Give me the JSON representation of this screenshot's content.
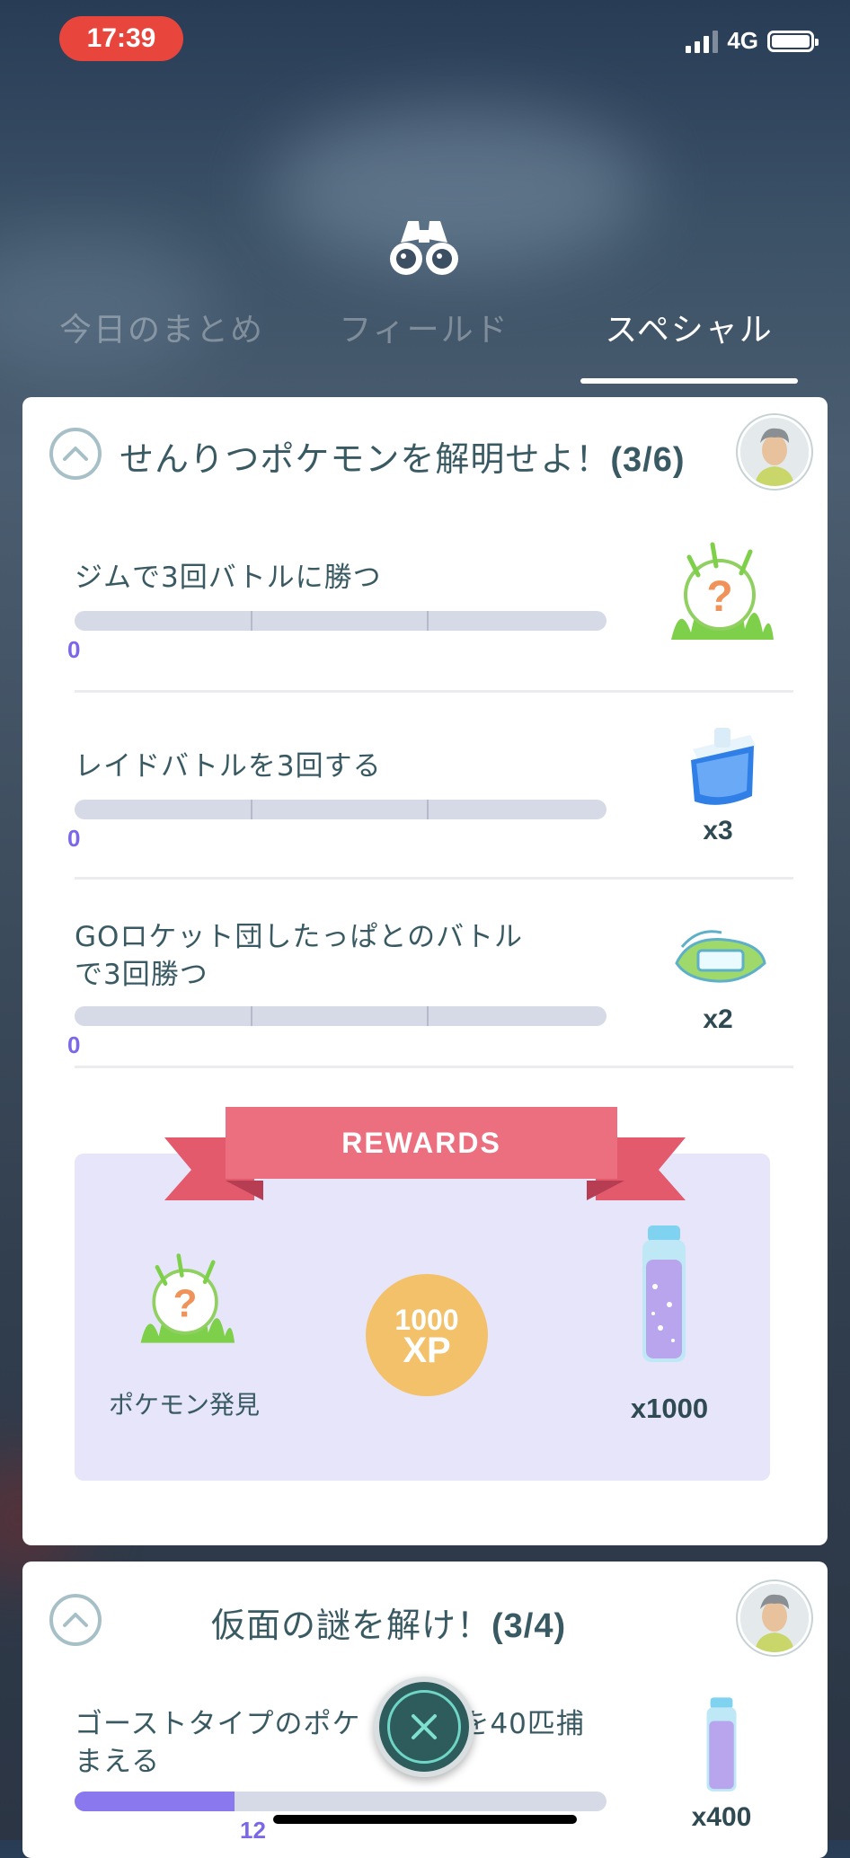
{
  "status_bar": {
    "time": "17:39",
    "network": "4G"
  },
  "header": {
    "icon": "binoculars-icon"
  },
  "tabs": [
    {
      "label": "今日のまとめ",
      "active": false
    },
    {
      "label": "フィールド",
      "active": false
    },
    {
      "label": "スペシャル",
      "active": true
    }
  ],
  "research1": {
    "title": "せんりつポケモンを解明せよ！",
    "progress": "(3/6)",
    "tasks": [
      {
        "text": "ジムで3回バトルに勝つ",
        "progress": "0",
        "reward_icon": "encounter-grass-icon",
        "qty": ""
      },
      {
        "text": "レイドバトルを3回する",
        "progress": "0",
        "reward_icon": "raid-pass-icon",
        "qty": "x3"
      },
      {
        "text_line1": "GOロケット団したっぱとのバトル",
        "text_line2": "で3回勝つ",
        "progress": "0",
        "reward_icon": "super-incubator-icon",
        "qty": "x2"
      }
    ],
    "rewards": {
      "banner": "REWARDS",
      "items": [
        {
          "icon": "encounter-grass-icon",
          "label": "ポケモン発見"
        },
        {
          "icon": "xp-coin-icon",
          "amount": "1000",
          "unit": "XP"
        },
        {
          "icon": "stardust-bottle-icon",
          "label": "x1000"
        }
      ]
    }
  },
  "research2": {
    "title": "仮面の謎を解け！",
    "progress": "(3/4)",
    "task": {
      "text_line1_a": "ゴーストタイプのポケ",
      "text_line1_b": "を40匹捕",
      "text_line2": "まえる",
      "progress": "12",
      "progress_fraction": 0.3,
      "qty": "x400"
    }
  },
  "colors": {
    "accent": "#7b68e8",
    "banner": "#ec6f80",
    "xp": "#f2c169",
    "time_pill": "#e8463c"
  }
}
